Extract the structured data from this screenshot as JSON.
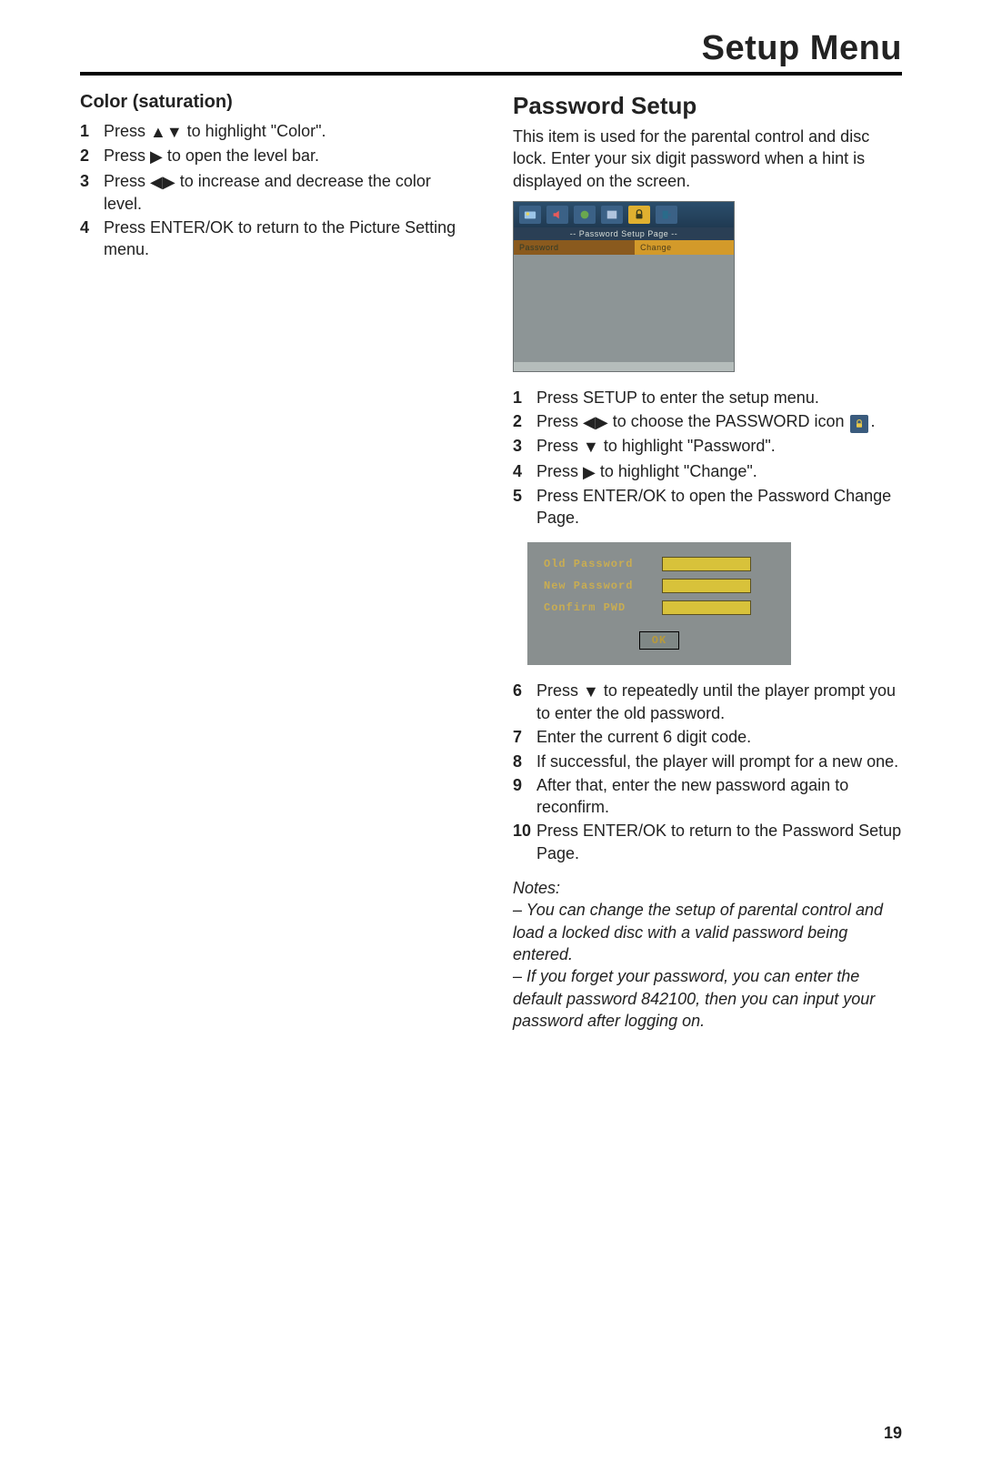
{
  "header": {
    "title": "Setup Menu"
  },
  "left": {
    "heading": "Color (saturation)",
    "steps": [
      {
        "n": "1",
        "pre": "Press ",
        "icons": "updown",
        "post": " to highlight \"Color\"."
      },
      {
        "n": "2",
        "pre": "Press ",
        "icons": "right",
        "post": " to open the level bar."
      },
      {
        "n": "3",
        "pre": "Press ",
        "icons": "leftright",
        "post": " to increase and decrease the color level."
      },
      {
        "n": "4",
        "pre": "",
        "icons": "",
        "post": "Press ENTER/OK to return to the Picture Setting menu."
      }
    ]
  },
  "right": {
    "heading": "Password Setup",
    "intro": "This item is used for the parental control and disc lock. Enter your six digit password when a hint is displayed on the screen.",
    "shot1": {
      "title": "--  Password  Setup  Page  --",
      "row_l": "Password",
      "row_r": "Change"
    },
    "stepsA": [
      {
        "n": "1",
        "pre": "",
        "icons": "",
        "post": "Press SETUP to enter the setup menu."
      },
      {
        "n": "2",
        "pre": "Press ",
        "icons": "leftright",
        "post": " to choose the PASSWORD icon ",
        "trail_lock": true,
        "trail": "."
      },
      {
        "n": "3",
        "pre": "Press ",
        "icons": "down",
        "post": " to highlight \"Password\"."
      },
      {
        "n": "4",
        "pre": "Press ",
        "icons": "right",
        "post": " to highlight \"Change\"."
      },
      {
        "n": "5",
        "pre": "",
        "icons": "",
        "post": "Press ENTER/OK to open the Password Change Page."
      }
    ],
    "shot2": {
      "l1": "Old  Password",
      "l2": "New  Password",
      "l3": "Confirm  PWD",
      "ok": "OK"
    },
    "stepsB": [
      {
        "n": "6",
        "pre": "Press ",
        "icons": "down",
        "post": " to repeatedly until the player prompt you to enter the old password."
      },
      {
        "n": "7",
        "pre": "",
        "icons": "",
        "post": "Enter the current 6 digit code."
      },
      {
        "n": "8",
        "pre": "",
        "icons": "",
        "post": "If successful, the player will prompt for a new one."
      },
      {
        "n": "9",
        "pre": "",
        "icons": "",
        "post": "After that, enter the new password again to reconfirm."
      },
      {
        "n": "10",
        "pre": "",
        "icons": "",
        "post": "Press ENTER/OK to return to the Password Setup Page."
      }
    ],
    "notes": {
      "title": "Notes:",
      "n1": "–  You can change the setup of parental control and load a locked disc with a valid password being entered.",
      "n2": "–  If you forget your password, you can enter the default password 842100, then you can input your password after logging on."
    }
  },
  "pagenum": "19"
}
